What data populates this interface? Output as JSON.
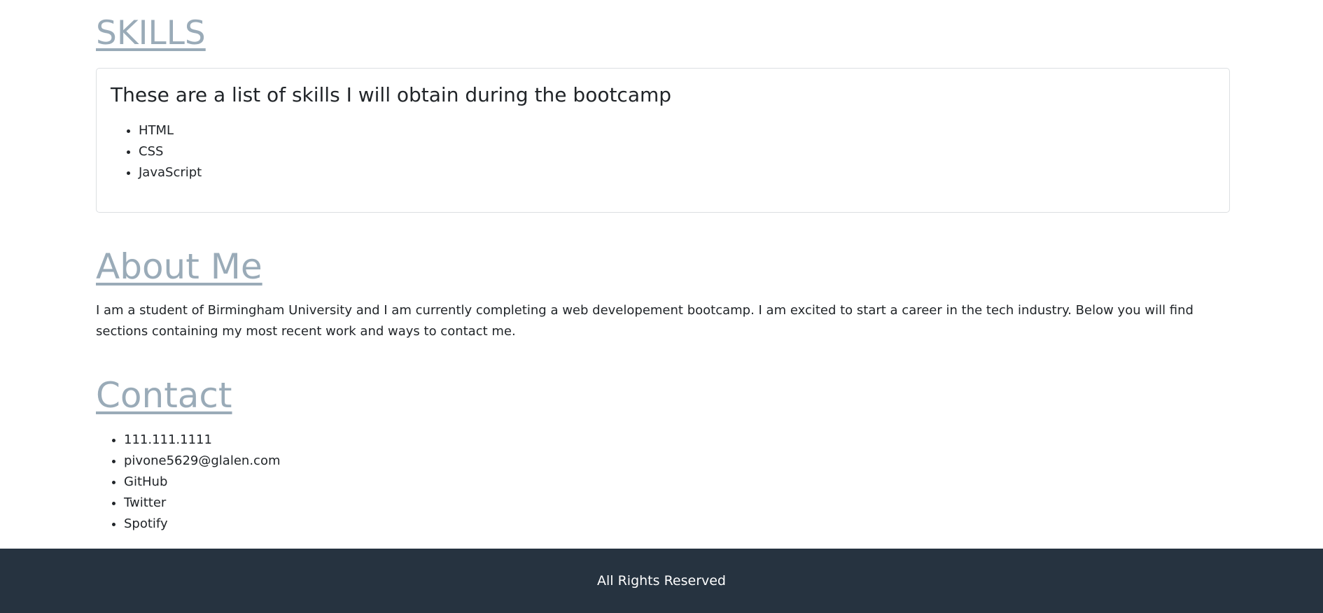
{
  "skills": {
    "heading": "SKILLS",
    "card_title": "These are a list of skills I will obtain during the bootcamp",
    "items": [
      "HTML",
      "CSS",
      "JavaScript"
    ]
  },
  "about": {
    "heading": "About Me",
    "text": "I am a student of Birmingham University and I am currently completing a web developement bootcamp. I am excited to start a career in the tech industry. Below you will find sections containing my most recent work and ways to contact me."
  },
  "contact": {
    "heading": "Contact",
    "items": [
      "111.111.1111",
      "pivone5629@glalen.com",
      "GitHub",
      "Twitter",
      "Spotify"
    ]
  },
  "footer": {
    "text": "All Rights Reserved"
  },
  "colors": {
    "heading": "#9aabb8",
    "footer_bg": "#263340",
    "text": "#212529"
  }
}
